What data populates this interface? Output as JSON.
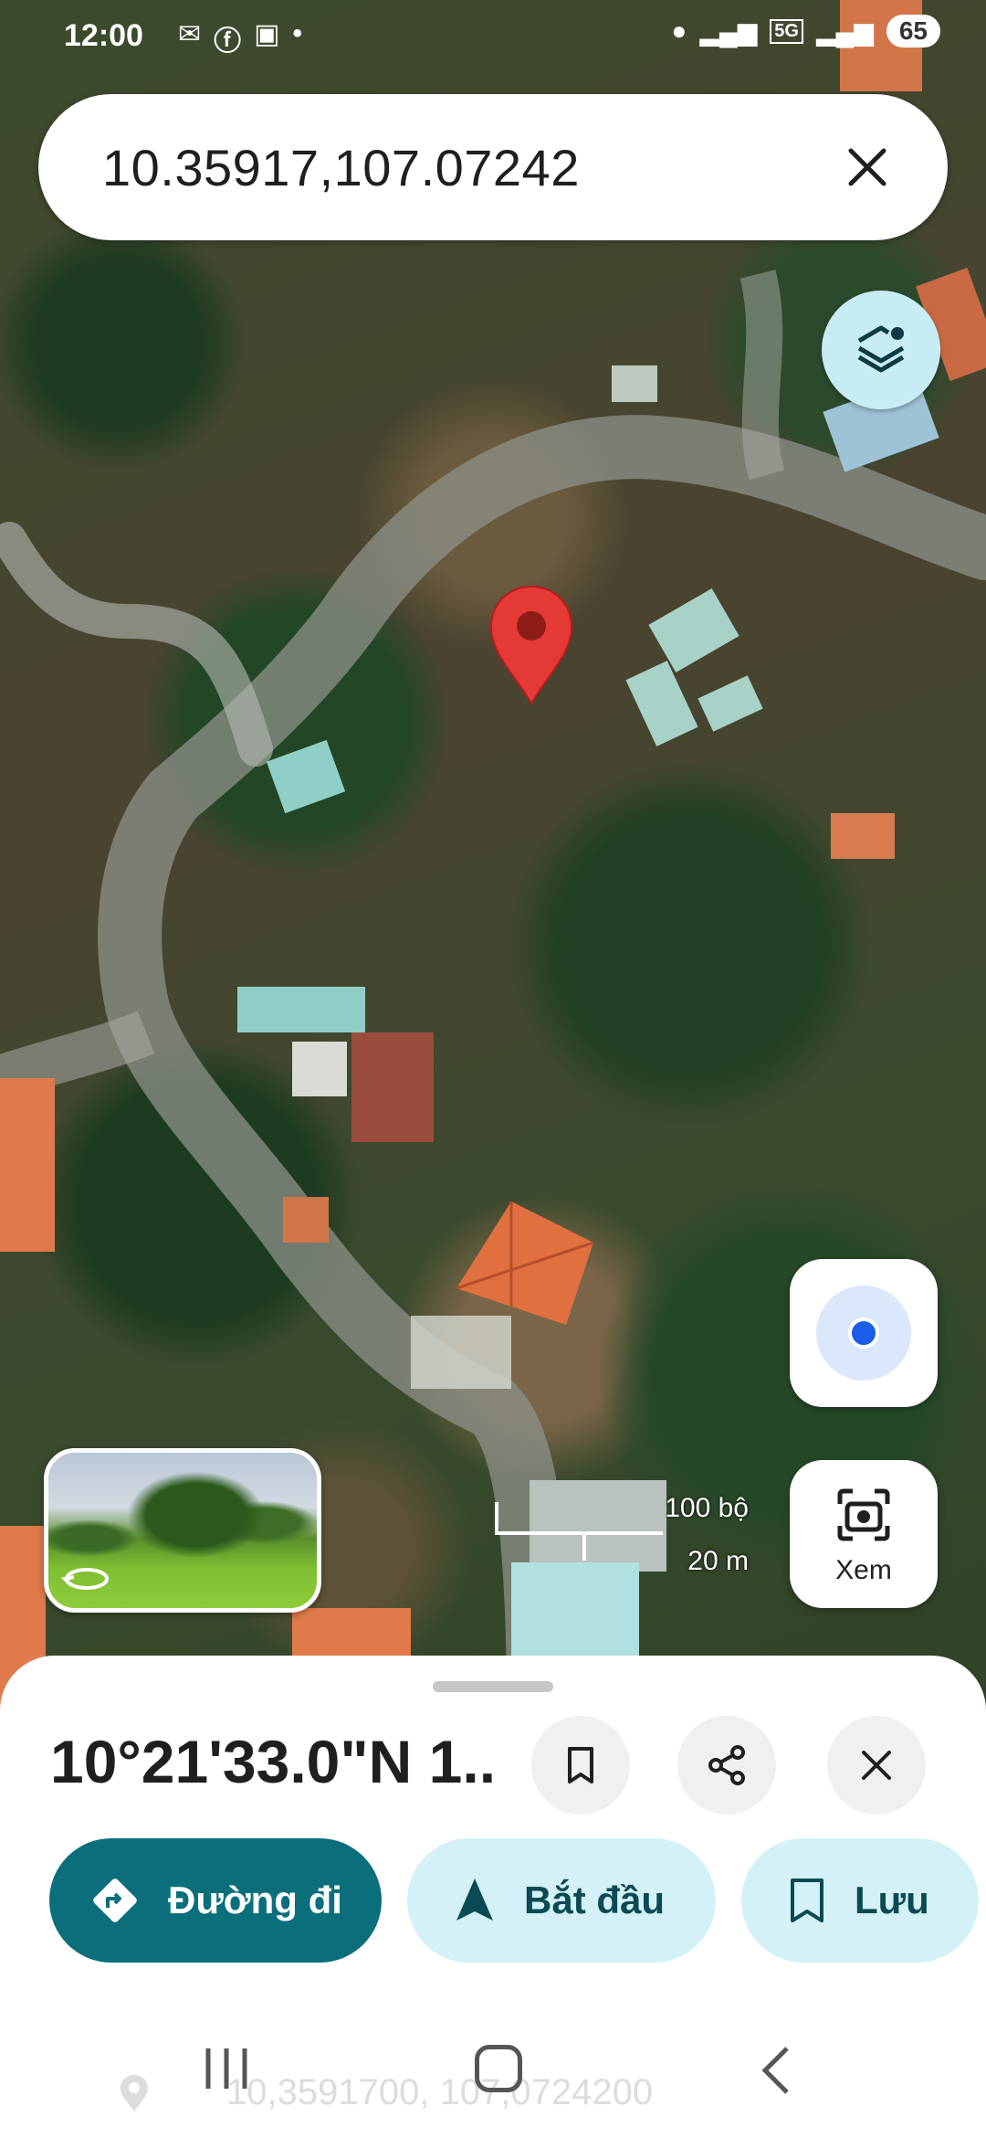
{
  "status_bar": {
    "time": "12:00",
    "network": "5G",
    "battery": "65"
  },
  "search": {
    "value": "10.35917,107.07242"
  },
  "map": {
    "scale_top": "100 bộ",
    "scale_bottom": "20 m"
  },
  "view_button": {
    "label": "Xem"
  },
  "place": {
    "title": "10°21'33.0\"N 1..."
  },
  "actions": {
    "directions_label": "Đường đi",
    "start_label": "Bắt đầu",
    "save_label": "Lưu"
  },
  "ghost_row": {
    "text": "10,3591700, 107,0724200"
  },
  "colors": {
    "primary": "#0b6e7b",
    "secondary": "#d3f1f7",
    "pin": "#e53935",
    "location_dot": "#1a5ee8"
  }
}
